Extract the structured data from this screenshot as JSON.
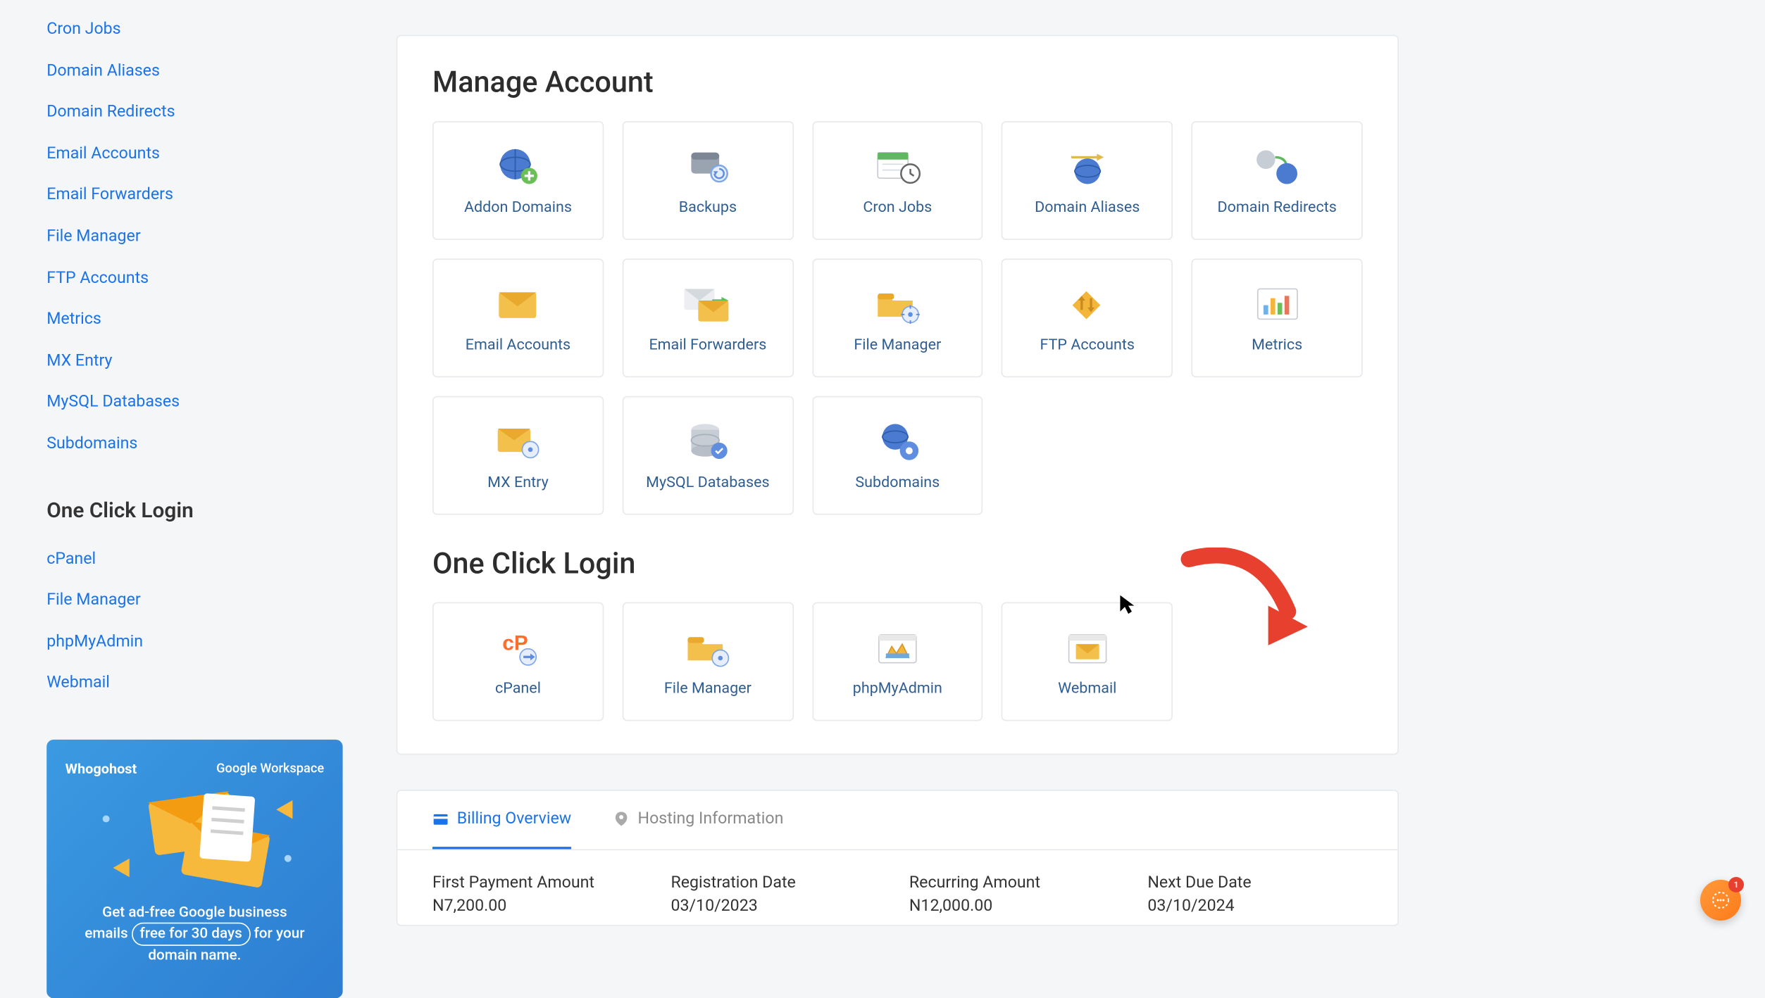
{
  "sidebar": {
    "links": [
      "Cron Jobs",
      "Domain Aliases",
      "Domain Redirects",
      "Email Accounts",
      "Email Forwarders",
      "File Manager",
      "FTP Accounts",
      "Metrics",
      "MX Entry",
      "MySQL Databases",
      "Subdomains"
    ],
    "login_heading": "One Click Login",
    "login_links": [
      "cPanel",
      "File Manager",
      "phpMyAdmin",
      "Webmail"
    ],
    "promo": {
      "brand_left": "Whogohost",
      "brand_right": "Google Workspace",
      "line1": "Get ad-free Google business",
      "line2_pre": "emails ",
      "line2_pill": "free for 30 days",
      "line2_post": " for your",
      "line3": "domain name."
    }
  },
  "main": {
    "manage_title": "Manage Account",
    "manage_cards": [
      "Addon Domains",
      "Backups",
      "Cron Jobs",
      "Domain Aliases",
      "Domain Redirects",
      "Email Accounts",
      "Email Forwarders",
      "File Manager",
      "FTP Accounts",
      "Metrics",
      "MX Entry",
      "MySQL Databases",
      "Subdomains"
    ],
    "login_title": "One Click Login",
    "login_cards": [
      "cPanel",
      "File Manager",
      "phpMyAdmin",
      "Webmail"
    ]
  },
  "tabs": {
    "billing": "Billing Overview",
    "hosting": "Hosting Information"
  },
  "billing": {
    "items": [
      {
        "label": "First Payment Amount",
        "value": "N7,200.00"
      },
      {
        "label": "Registration Date",
        "value": "03/10/2023"
      },
      {
        "label": "Recurring Amount",
        "value": "N12,000.00"
      },
      {
        "label": "Next Due Date",
        "value": "03/10/2024"
      }
    ]
  },
  "chat": {
    "badge": "1"
  }
}
